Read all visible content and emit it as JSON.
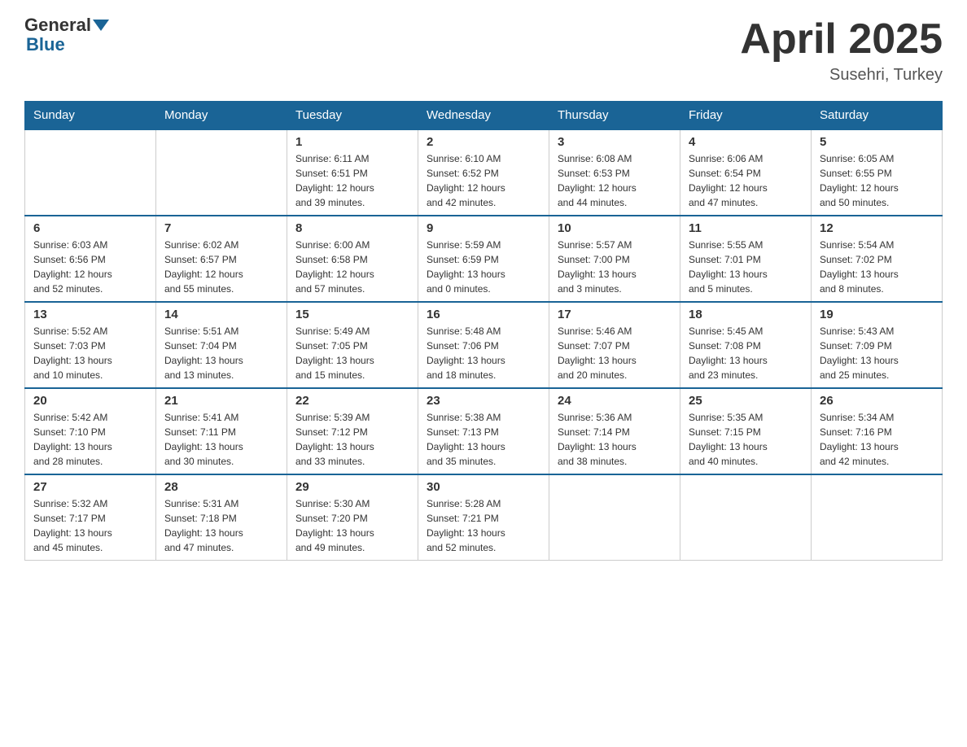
{
  "header": {
    "logo_general": "General",
    "logo_blue": "Blue",
    "title": "April 2025",
    "location": "Susehri, Turkey"
  },
  "weekdays": [
    "Sunday",
    "Monday",
    "Tuesday",
    "Wednesday",
    "Thursday",
    "Friday",
    "Saturday"
  ],
  "weeks": [
    [
      {
        "day": "",
        "info": ""
      },
      {
        "day": "",
        "info": ""
      },
      {
        "day": "1",
        "info": "Sunrise: 6:11 AM\nSunset: 6:51 PM\nDaylight: 12 hours\nand 39 minutes."
      },
      {
        "day": "2",
        "info": "Sunrise: 6:10 AM\nSunset: 6:52 PM\nDaylight: 12 hours\nand 42 minutes."
      },
      {
        "day": "3",
        "info": "Sunrise: 6:08 AM\nSunset: 6:53 PM\nDaylight: 12 hours\nand 44 minutes."
      },
      {
        "day": "4",
        "info": "Sunrise: 6:06 AM\nSunset: 6:54 PM\nDaylight: 12 hours\nand 47 minutes."
      },
      {
        "day": "5",
        "info": "Sunrise: 6:05 AM\nSunset: 6:55 PM\nDaylight: 12 hours\nand 50 minutes."
      }
    ],
    [
      {
        "day": "6",
        "info": "Sunrise: 6:03 AM\nSunset: 6:56 PM\nDaylight: 12 hours\nand 52 minutes."
      },
      {
        "day": "7",
        "info": "Sunrise: 6:02 AM\nSunset: 6:57 PM\nDaylight: 12 hours\nand 55 minutes."
      },
      {
        "day": "8",
        "info": "Sunrise: 6:00 AM\nSunset: 6:58 PM\nDaylight: 12 hours\nand 57 minutes."
      },
      {
        "day": "9",
        "info": "Sunrise: 5:59 AM\nSunset: 6:59 PM\nDaylight: 13 hours\nand 0 minutes."
      },
      {
        "day": "10",
        "info": "Sunrise: 5:57 AM\nSunset: 7:00 PM\nDaylight: 13 hours\nand 3 minutes."
      },
      {
        "day": "11",
        "info": "Sunrise: 5:55 AM\nSunset: 7:01 PM\nDaylight: 13 hours\nand 5 minutes."
      },
      {
        "day": "12",
        "info": "Sunrise: 5:54 AM\nSunset: 7:02 PM\nDaylight: 13 hours\nand 8 minutes."
      }
    ],
    [
      {
        "day": "13",
        "info": "Sunrise: 5:52 AM\nSunset: 7:03 PM\nDaylight: 13 hours\nand 10 minutes."
      },
      {
        "day": "14",
        "info": "Sunrise: 5:51 AM\nSunset: 7:04 PM\nDaylight: 13 hours\nand 13 minutes."
      },
      {
        "day": "15",
        "info": "Sunrise: 5:49 AM\nSunset: 7:05 PM\nDaylight: 13 hours\nand 15 minutes."
      },
      {
        "day": "16",
        "info": "Sunrise: 5:48 AM\nSunset: 7:06 PM\nDaylight: 13 hours\nand 18 minutes."
      },
      {
        "day": "17",
        "info": "Sunrise: 5:46 AM\nSunset: 7:07 PM\nDaylight: 13 hours\nand 20 minutes."
      },
      {
        "day": "18",
        "info": "Sunrise: 5:45 AM\nSunset: 7:08 PM\nDaylight: 13 hours\nand 23 minutes."
      },
      {
        "day": "19",
        "info": "Sunrise: 5:43 AM\nSunset: 7:09 PM\nDaylight: 13 hours\nand 25 minutes."
      }
    ],
    [
      {
        "day": "20",
        "info": "Sunrise: 5:42 AM\nSunset: 7:10 PM\nDaylight: 13 hours\nand 28 minutes."
      },
      {
        "day": "21",
        "info": "Sunrise: 5:41 AM\nSunset: 7:11 PM\nDaylight: 13 hours\nand 30 minutes."
      },
      {
        "day": "22",
        "info": "Sunrise: 5:39 AM\nSunset: 7:12 PM\nDaylight: 13 hours\nand 33 minutes."
      },
      {
        "day": "23",
        "info": "Sunrise: 5:38 AM\nSunset: 7:13 PM\nDaylight: 13 hours\nand 35 minutes."
      },
      {
        "day": "24",
        "info": "Sunrise: 5:36 AM\nSunset: 7:14 PM\nDaylight: 13 hours\nand 38 minutes."
      },
      {
        "day": "25",
        "info": "Sunrise: 5:35 AM\nSunset: 7:15 PM\nDaylight: 13 hours\nand 40 minutes."
      },
      {
        "day": "26",
        "info": "Sunrise: 5:34 AM\nSunset: 7:16 PM\nDaylight: 13 hours\nand 42 minutes."
      }
    ],
    [
      {
        "day": "27",
        "info": "Sunrise: 5:32 AM\nSunset: 7:17 PM\nDaylight: 13 hours\nand 45 minutes."
      },
      {
        "day": "28",
        "info": "Sunrise: 5:31 AM\nSunset: 7:18 PM\nDaylight: 13 hours\nand 47 minutes."
      },
      {
        "day": "29",
        "info": "Sunrise: 5:30 AM\nSunset: 7:20 PM\nDaylight: 13 hours\nand 49 minutes."
      },
      {
        "day": "30",
        "info": "Sunrise: 5:28 AM\nSunset: 7:21 PM\nDaylight: 13 hours\nand 52 minutes."
      },
      {
        "day": "",
        "info": ""
      },
      {
        "day": "",
        "info": ""
      },
      {
        "day": "",
        "info": ""
      }
    ]
  ]
}
